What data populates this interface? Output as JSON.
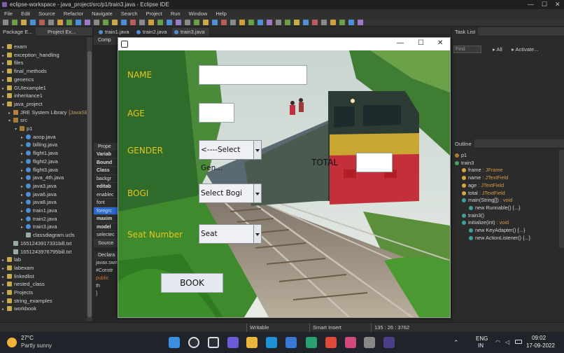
{
  "window": {
    "title": "eclipse-workspace - java_project/src/p1/train3.java - Eclipse IDE"
  },
  "menu": [
    "File",
    "Edit",
    "Source",
    "Refactor",
    "Navigate",
    "Search",
    "Project",
    "Run",
    "Window",
    "Help"
  ],
  "views": {
    "left_tabs": [
      "Package E...",
      "Project Ex..."
    ],
    "task_list": "Task List",
    "outline": "Outline",
    "find_placeholder": "Find",
    "all_label": "All",
    "activate_label": "Activate..."
  },
  "editor_tabs": [
    "train1.java",
    "train2.java",
    "train3.java"
  ],
  "tree": [
    {
      "label": "exam",
      "depth": 0,
      "icon": "prj",
      "open": false
    },
    {
      "label": "exception_handling",
      "depth": 0,
      "icon": "prj",
      "open": false
    },
    {
      "label": "files",
      "depth": 0,
      "icon": "prj",
      "open": false
    },
    {
      "label": "final_methods",
      "depth": 0,
      "icon": "prj",
      "open": false
    },
    {
      "label": "generics",
      "depth": 0,
      "icon": "prj",
      "open": false
    },
    {
      "label": "GUIexample1",
      "depth": 0,
      "icon": "prj",
      "open": false
    },
    {
      "label": "inheritance1",
      "depth": 0,
      "icon": "prj",
      "open": false
    },
    {
      "label": "java_project",
      "depth": 0,
      "icon": "prj",
      "open": true
    },
    {
      "label": "JRE System Library",
      "suffix": "[JavaSE-",
      "depth": 1,
      "icon": "lib",
      "open": false
    },
    {
      "label": "src",
      "depth": 1,
      "icon": "pkg",
      "open": true
    },
    {
      "label": "p1",
      "depth": 2,
      "icon": "pkg",
      "open": true
    },
    {
      "label": "aoop.java",
      "depth": 3,
      "icon": "jav",
      "open": false
    },
    {
      "label": "billing.java",
      "depth": 3,
      "icon": "jav",
      "open": false
    },
    {
      "label": "flight1.java",
      "depth": 3,
      "icon": "jav",
      "open": false
    },
    {
      "label": "flight2.java",
      "depth": 3,
      "icon": "jav",
      "open": false
    },
    {
      "label": "flight3.java",
      "depth": 3,
      "icon": "jav",
      "open": false
    },
    {
      "label": "java_4th.java",
      "depth": 3,
      "icon": "jav",
      "open": false
    },
    {
      "label": "java3.java",
      "depth": 3,
      "icon": "jav",
      "open": false
    },
    {
      "label": "java6.java",
      "depth": 3,
      "icon": "jav",
      "open": false
    },
    {
      "label": "java8.java",
      "depth": 3,
      "icon": "jav",
      "open": false
    },
    {
      "label": "train1.java",
      "depth": 3,
      "icon": "jav",
      "open": false
    },
    {
      "label": "train2.java",
      "depth": 3,
      "icon": "jav",
      "open": false
    },
    {
      "label": "train3.java",
      "depth": 3,
      "icon": "jav",
      "open": false
    },
    {
      "label": "classdiagram.ucls",
      "depth": 3,
      "icon": "txt",
      "open": null
    },
    {
      "label": "1651243917331bill.txt",
      "depth": 1,
      "icon": "txt",
      "open": null
    },
    {
      "label": "1651243976795bill.txt",
      "depth": 1,
      "icon": "txt",
      "open": null
    },
    {
      "label": "lab",
      "depth": 0,
      "icon": "prj",
      "open": false
    },
    {
      "label": "labexam",
      "depth": 0,
      "icon": "prj",
      "open": false
    },
    {
      "label": "linkedlist",
      "depth": 0,
      "icon": "prj",
      "open": false
    },
    {
      "label": "nested_class",
      "depth": 0,
      "icon": "prj",
      "open": false
    },
    {
      "label": "Projects",
      "depth": 0,
      "icon": "prj",
      "open": false
    },
    {
      "label": "string_examples",
      "depth": 0,
      "icon": "prj",
      "open": false
    },
    {
      "label": "workbook",
      "depth": 0,
      "icon": "prj",
      "open": false
    }
  ],
  "hidden_editor": {
    "comp_tab": "Comp",
    "props_tab": "Prope",
    "props": [
      {
        "t": "Variab",
        "b": true,
        "sel": false
      },
      {
        "t": "Bound",
        "b": true,
        "sel": false
      },
      {
        "t": "Class",
        "b": true,
        "sel": false
      },
      {
        "t": "backgr",
        "b": false,
        "sel": false
      },
      {
        "t": "editab",
        "b": true,
        "sel": false
      },
      {
        "t": "enablec",
        "b": false,
        "sel": false
      },
      {
        "t": "font",
        "b": false,
        "sel": false
      },
      {
        "t": "foregrc",
        "b": false,
        "sel": true
      },
      {
        "t": "maxim",
        "b": true,
        "sel": false
      },
      {
        "t": "model",
        "b": true,
        "sel": false
      },
      {
        "t": "selectec",
        "b": false,
        "sel": false
      }
    ],
    "source_tab": "Source",
    "declare_tab": "Declara",
    "code": [
      "javax.swin",
      "#Constr",
      "public",
      "  th",
      "}"
    ]
  },
  "outline": [
    {
      "label": "p1",
      "depth": 0,
      "type": "",
      "kind": "pkg"
    },
    {
      "label": "train3",
      "depth": 0,
      "type": "",
      "kind": "cls"
    },
    {
      "label": "frame",
      "depth": 1,
      "type": " : JFrame",
      "kind": "field"
    },
    {
      "label": "name",
      "depth": 1,
      "type": " : JTextField",
      "kind": "field"
    },
    {
      "label": "age",
      "depth": 1,
      "type": " : JTextField",
      "kind": "field"
    },
    {
      "label": "total",
      "depth": 1,
      "type": " : JTextField",
      "kind": "field"
    },
    {
      "label": "main(String[])",
      "depth": 1,
      "type": " : void",
      "kind": "method"
    },
    {
      "label": "new Runnable() {...}",
      "depth": 2,
      "type": "",
      "kind": "method"
    },
    {
      "label": "train3()",
      "depth": 1,
      "type": "",
      "kind": "method"
    },
    {
      "label": "initialize(int)",
      "depth": 1,
      "type": " : void",
      "kind": "method"
    },
    {
      "label": "new KeyAdapter() {...}",
      "depth": 2,
      "type": "",
      "kind": "method"
    },
    {
      "label": "new ActionListener() {...}",
      "depth": 2,
      "type": "",
      "kind": "method"
    }
  ],
  "status": {
    "writable": "Writable",
    "insert_mode": "Smart Insert",
    "position": "135 : 26 : 3762"
  },
  "taskbar": {
    "temperature": "27°C",
    "weather": "Partly sunny",
    "lang1": "ENG",
    "lang2": "IN",
    "time": "09:02",
    "date": "17-09-2022"
  },
  "app": {
    "name_label": "NAME",
    "age_label": "AGE",
    "gender_label": "GENDER",
    "gender_value": "<----Select Gen...",
    "bogi_label": "BOGI",
    "bogi_value": "Select Bogi",
    "seat_label": "Seat Number",
    "seat_value": "Seat",
    "total_label": "TOTAL",
    "book_label": "BOOK"
  },
  "colors": {
    "label_yellow": "#e7c51f",
    "selection_blue": "#2a6ad3"
  }
}
